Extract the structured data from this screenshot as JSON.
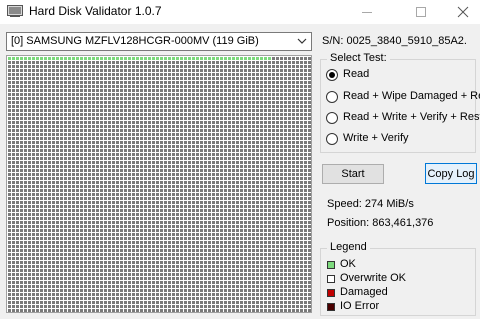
{
  "window": {
    "title": "Hard Disk Validator 1.0.7"
  },
  "disk": {
    "selected": "[0] SAMSUNG MZFLV128HCGR-000MV (119 GiB)",
    "serial": "S/N: 0025_3840_5910_85A2."
  },
  "test": {
    "group_label": "Select Test:",
    "options": [
      {
        "label": "Read",
        "selected": true
      },
      {
        "label": "Read + Wipe Damaged + Read",
        "selected": false
      },
      {
        "label": "Read + Write + Verify + Restore",
        "selected": false
      },
      {
        "label": "Write + Verify",
        "selected": false
      }
    ]
  },
  "buttons": {
    "start": "Start",
    "copy_log": "Copy Log"
  },
  "status": {
    "speed": "Speed: 274 MiB/s",
    "position": "Position: 863,461,376"
  },
  "legend": {
    "title": "Legend",
    "items": [
      {
        "label": "OK",
        "color": "#7cd97c"
      },
      {
        "label": "Overwrite OK",
        "color": "#ffffff"
      },
      {
        "label": "Damaged",
        "color": "#c00000"
      },
      {
        "label": "IO Error",
        "color": "#4a0000"
      }
    ]
  },
  "map": {
    "cell_colors": {
      "ok": "#7cd97c",
      "untested": "#7a7a7a"
    },
    "ok_fraction": 0.0135
  }
}
